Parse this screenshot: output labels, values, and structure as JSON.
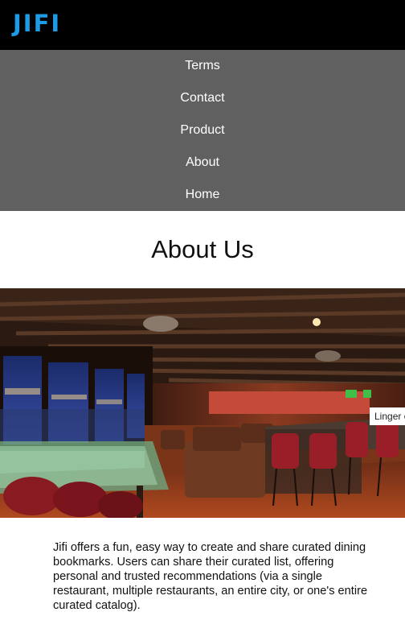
{
  "header": {
    "logo_text": "JIFI",
    "logo_color": "#1e9be6"
  },
  "nav": {
    "background": "#606060",
    "items": [
      {
        "label": "Terms"
      },
      {
        "label": "Contact"
      },
      {
        "label": "Product"
      },
      {
        "label": "About"
      },
      {
        "label": "Home"
      }
    ]
  },
  "main": {
    "title": "About Us",
    "hero": {
      "caption": "Linger on"
    },
    "paragraph": "Jifi offers a fun, easy way to create and share curated dining bookmarks. Users can share their curated list, offering personal and trusted recommendations (via a single restaurant, multiple restaurants, an entire city, or one's entire curated catalog)."
  }
}
